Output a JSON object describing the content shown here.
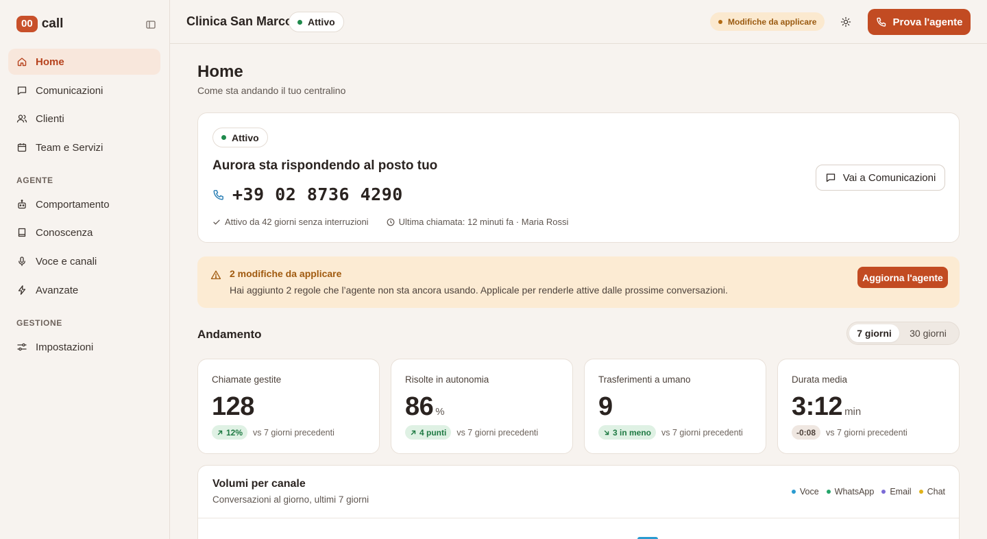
{
  "brand": {
    "badge": "00",
    "name": "call"
  },
  "sidebar": {
    "items": [
      {
        "label": "Home",
        "icon": "home-icon"
      },
      {
        "label": "Comunicazioni",
        "icon": "message-icon"
      },
      {
        "label": "Clienti",
        "icon": "users-icon"
      },
      {
        "label": "Team e Servizi",
        "icon": "calendar-icon"
      },
      {
        "label": "Comportamento",
        "icon": "bot-icon"
      },
      {
        "label": "Conoscenza",
        "icon": "book-icon"
      },
      {
        "label": "Voce e canali",
        "icon": "mic-icon"
      },
      {
        "label": "Avanzate",
        "icon": "bolt-icon"
      },
      {
        "label": "Impostazioni",
        "icon": "sliders-icon"
      }
    ],
    "sections": {
      "agente": "AGENTE",
      "gestione": "GESTIONE"
    }
  },
  "topbar": {
    "clinic": "Clinica San Marco",
    "status": "Attivo",
    "pending": "Modifiche da applicare",
    "cta": "Prova l'agente"
  },
  "page": {
    "title": "Home",
    "subtitle": "Come sta andando il tuo centralino"
  },
  "status_card": {
    "status": "Attivo",
    "headline": "Aurora sta rispondendo al posto tuo",
    "phone": "+39 02 8736 4290",
    "uptime": "Attivo da 42 giorni senza interruzioni",
    "last_call": "Ultima chiamata: 12 minuti fa · Maria Rossi",
    "button": "Vai a Comunicazioni"
  },
  "alert": {
    "title": "2 modifiche da applicare",
    "text": "Hai aggiunto 2 regole che l’agente non sta ancora usando. Applicale per renderle attive dalle prossime conversazioni.",
    "button": "Aggiorna l'agente"
  },
  "trend": {
    "title": "Andamento",
    "ranges": [
      "7 giorni",
      "30 giorni"
    ],
    "selected": "7 giorni"
  },
  "kpis": [
    {
      "label": "Chiamate gestite",
      "value": "128",
      "unit": "",
      "delta": "12%",
      "delta_dir": "up",
      "compare": "vs 7 giorni precedenti"
    },
    {
      "label": "Risolte in autonomia",
      "value": "86",
      "unit": "%",
      "delta": "4 punti",
      "delta_dir": "up",
      "compare": "vs 7 giorni precedenti"
    },
    {
      "label": "Trasferimenti a umano",
      "value": "9",
      "unit": "",
      "delta": "3 in meno",
      "delta_dir": "down",
      "compare": "vs 7 giorni precedenti"
    },
    {
      "label": "Durata media",
      "value": "3:12",
      "unit": "min",
      "delta": "-0:08",
      "delta_dir": "neutral",
      "compare": "vs 7 giorni precedenti"
    }
  ],
  "volumes": {
    "title": "Volumi per canale",
    "subtitle": "Conversazioni al giorno, ultimi 7 giorni",
    "legend": [
      {
        "name": "Voce",
        "color": "#2a9bd0"
      },
      {
        "name": "WhatsApp",
        "color": "#25a56a"
      },
      {
        "name": "Email",
        "color": "#7b6bd6"
      },
      {
        "name": "Chat",
        "color": "#e0b21a"
      }
    ]
  },
  "colors": {
    "accent": "#c24b22",
    "active": "#1f8a4c",
    "warning_bg": "#fcebd3"
  }
}
